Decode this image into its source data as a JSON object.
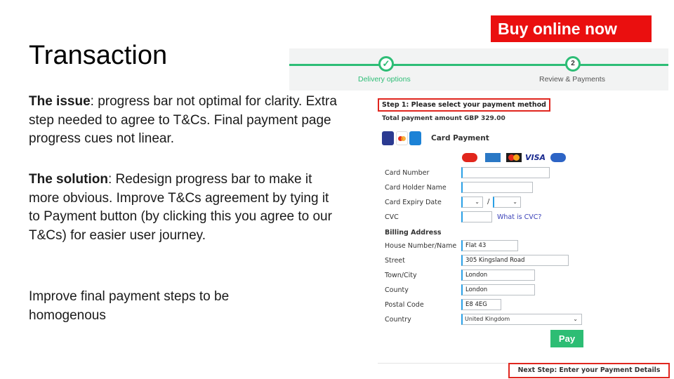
{
  "slide": {
    "title": "Transaction",
    "issue_label": "The issue",
    "issue_text": ": progress bar not optimal for clarity. Extra step needed to agree to T&Cs. Final payment page progress cues not linear.",
    "solution_label": "The solution",
    "solution_text": ": Redesign progress bar to make it more obvious. Improve T&Cs agreement by tying it to Payment button (by clicking this you agree to our T&Cs) for easier user journey.",
    "improve_text": "Improve final payment steps to be homogenous",
    "buy_button": "Buy online now"
  },
  "progress": {
    "step1_label": "Delivery options",
    "step1_icon": "check-icon",
    "step2_number": "2",
    "step2_label": "Review & Payments",
    "color": "#2ebd76"
  },
  "payment": {
    "step_heading": "Step 1: Please select your payment method",
    "total": "Total payment amount GBP 329.00",
    "card_title": "Card Payment",
    "brand_logos": [
      "maestro-icon",
      "amex-icon",
      "mastercard-icon",
      "VISA",
      "maestro-icon"
    ],
    "fields": {
      "card_number": {
        "label": "Card Number",
        "value": ""
      },
      "holder_name": {
        "label": "Card Holder Name",
        "value": ""
      },
      "expiry": {
        "label": "Card Expiry Date",
        "month": "",
        "separator": "/",
        "year": ""
      },
      "cvc": {
        "label": "CVC",
        "value": "",
        "link": "What is CVC?"
      }
    },
    "billing": {
      "heading": "Billing Address",
      "house": {
        "label": "House Number/Name",
        "value": "Flat 43"
      },
      "street": {
        "label": "Street",
        "value": "305 Kingsland Road"
      },
      "town": {
        "label": "Town/City",
        "value": "London"
      },
      "county": {
        "label": "County",
        "value": "London"
      },
      "postal": {
        "label": "Postal Code",
        "value": "E8 4EG"
      },
      "country": {
        "label": "Country",
        "value": "United Kingdom"
      }
    },
    "pay_button": "Pay",
    "next_step": "Next Step: Enter your Payment Details",
    "accent_color": "#2dbd74",
    "highlight_color": "#e0261f"
  }
}
